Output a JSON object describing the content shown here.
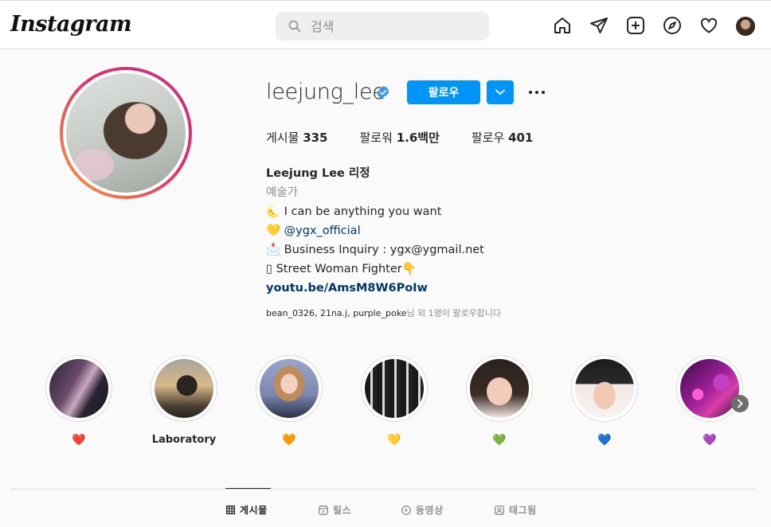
{
  "app": {
    "logo_text": "Instagram"
  },
  "search": {
    "placeholder": "검색"
  },
  "nav_icons": [
    "home-icon",
    "direct-message-icon",
    "new-post-icon",
    "explore-icon",
    "activity-heart-icon",
    "profile-avatar"
  ],
  "profile": {
    "username": "leejung_lee",
    "verified": true,
    "follow_label": "팔로우",
    "stats": {
      "posts_label": "게시물",
      "posts_value": "335",
      "followers_label": "팔로워",
      "followers_value": "1.6백만",
      "following_label": "팔로우",
      "following_value": "401"
    },
    "bio": {
      "name": "Leejung Lee 리정",
      "category": "예술가",
      "line1": "🌜 I can be anything you want",
      "line2_emoji": "💛",
      "line2_mention": "@ygx_official",
      "line3": "📩 Business Inquiry : ygx@ygmail.net",
      "line4": "▯ Street Woman Fighter👇",
      "link": "youtu.be/AmsM8W6PoIw"
    },
    "followed_by": {
      "names": "bean_0326, 21na.j, purple_poke",
      "suffix": "님 외 1명이 팔로우합니다"
    }
  },
  "highlights": [
    {
      "label": "❤️",
      "color": "#e0245e"
    },
    {
      "label": "Laboratory",
      "color": ""
    },
    {
      "label": "🧡",
      "color": "#f4900c"
    },
    {
      "label": "💛",
      "color": "#ffcc00"
    },
    {
      "label": "💚",
      "color": "#21b24b"
    },
    {
      "label": "💙",
      "color": "#1d8cf0"
    },
    {
      "label": "💜",
      "color": "#9b6ad6"
    }
  ],
  "tabs": [
    {
      "label": "게시물",
      "icon": "grid-icon",
      "active": true
    },
    {
      "label": "릴스",
      "icon": "reels-icon",
      "active": false
    },
    {
      "label": "동영상",
      "icon": "video-play-icon",
      "active": false
    },
    {
      "label": "태그됨",
      "icon": "tagged-icon",
      "active": false
    }
  ],
  "colors": {
    "accent": "#0095f6",
    "text": "#262626",
    "muted": "#8e8e8e",
    "link": "#00376b"
  }
}
